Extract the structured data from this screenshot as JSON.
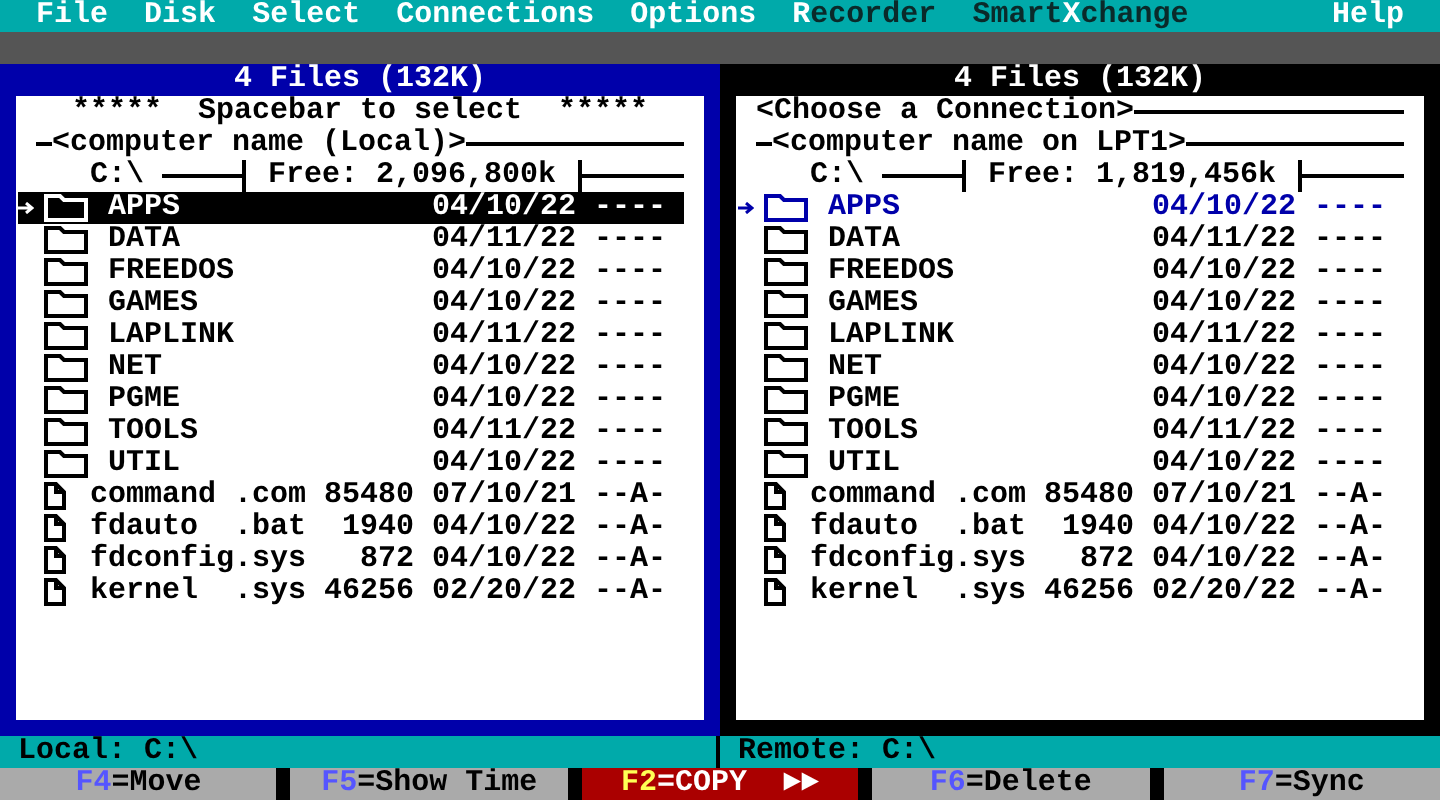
{
  "menu": [
    {
      "hotkey": "F",
      "rest": "ile",
      "bright": true
    },
    {
      "hotkey": "D",
      "rest": "isk",
      "bright": true
    },
    {
      "hotkey": "S",
      "rest": "elect",
      "bright": true
    },
    {
      "hotkey": "C",
      "rest": "onnections",
      "bright": true
    },
    {
      "hotkey": "O",
      "rest": "ptions",
      "bright": true
    },
    {
      "hotkey": "R",
      "rest": "ecorder",
      "bright": false
    },
    {
      "before": "Smart",
      "hotkey": "X",
      "rest": "change",
      "bright": false
    }
  ],
  "help": "Help",
  "panels": [
    {
      "active": true,
      "header": "4 Files (132K)",
      "banner": {
        "kind": "centered",
        "text": "*****  Spacebar to select  *****"
      },
      "computer": "<computer name (Local)>",
      "path": "C:\\",
      "free": "Free: 2,096,800k",
      "status": "Local: C:\\",
      "rows": [
        {
          "kind": "folder",
          "name": "APPS",
          "date": "04/10/22",
          "attr": "----",
          "selected": true
        },
        {
          "kind": "folder",
          "name": "DATA",
          "date": "04/11/22",
          "attr": "----",
          "selected": false
        },
        {
          "kind": "folder",
          "name": "FREEDOS",
          "date": "04/10/22",
          "attr": "----",
          "selected": false
        },
        {
          "kind": "folder",
          "name": "GAMES",
          "date": "04/10/22",
          "attr": "----",
          "selected": false
        },
        {
          "kind": "folder",
          "name": "LAPLINK",
          "date": "04/11/22",
          "attr": "----",
          "selected": false
        },
        {
          "kind": "folder",
          "name": "NET",
          "date": "04/10/22",
          "attr": "----",
          "selected": false
        },
        {
          "kind": "folder",
          "name": "PGME",
          "date": "04/10/22",
          "attr": "----",
          "selected": false
        },
        {
          "kind": "folder",
          "name": "TOOLS",
          "date": "04/11/22",
          "attr": "----",
          "selected": false
        },
        {
          "kind": "folder",
          "name": "UTIL",
          "date": "04/10/22",
          "attr": "----",
          "selected": false
        },
        {
          "kind": "file",
          "name": "command",
          "ext": ".com",
          "size": "85480",
          "date": "07/10/21",
          "attr": "--A-",
          "selected": false
        },
        {
          "kind": "file",
          "name": "fdauto",
          "ext": ".bat",
          "size": "1940",
          "date": "04/10/22",
          "attr": "--A-",
          "selected": false
        },
        {
          "kind": "file",
          "name": "fdconfig",
          "ext": ".sys",
          "size": "872",
          "date": "04/10/22",
          "attr": "--A-",
          "selected": false
        },
        {
          "kind": "file",
          "name": "kernel",
          "ext": ".sys",
          "size": "46256",
          "date": "02/20/22",
          "attr": "--A-",
          "selected": false
        }
      ]
    },
    {
      "active": false,
      "header": "4 Files (132K)",
      "banner": {
        "kind": "ruled",
        "text": "<Choose a Connection>"
      },
      "computer": "<computer name on LPT1>",
      "path": "C:\\",
      "free": "Free: 1,819,456k",
      "status": "Remote: C:\\",
      "rows": [
        {
          "kind": "folder",
          "name": "APPS",
          "date": "04/10/22",
          "attr": "----",
          "selected": true
        },
        {
          "kind": "folder",
          "name": "DATA",
          "date": "04/11/22",
          "attr": "----",
          "selected": false
        },
        {
          "kind": "folder",
          "name": "FREEDOS",
          "date": "04/10/22",
          "attr": "----",
          "selected": false
        },
        {
          "kind": "folder",
          "name": "GAMES",
          "date": "04/10/22",
          "attr": "----",
          "selected": false
        },
        {
          "kind": "folder",
          "name": "LAPLINK",
          "date": "04/11/22",
          "attr": "----",
          "selected": false
        },
        {
          "kind": "folder",
          "name": "NET",
          "date": "04/10/22",
          "attr": "----",
          "selected": false
        },
        {
          "kind": "folder",
          "name": "PGME",
          "date": "04/10/22",
          "attr": "----",
          "selected": false
        },
        {
          "kind": "folder",
          "name": "TOOLS",
          "date": "04/11/22",
          "attr": "----",
          "selected": false
        },
        {
          "kind": "folder",
          "name": "UTIL",
          "date": "04/10/22",
          "attr": "----",
          "selected": false
        },
        {
          "kind": "file",
          "name": "command",
          "ext": ".com",
          "size": "85480",
          "date": "07/10/21",
          "attr": "--A-",
          "selected": false
        },
        {
          "kind": "file",
          "name": "fdauto",
          "ext": ".bat",
          "size": "1940",
          "date": "04/10/22",
          "attr": "--A-",
          "selected": false
        },
        {
          "kind": "file",
          "name": "fdconfig",
          "ext": ".sys",
          "size": "872",
          "date": "04/10/22",
          "attr": "--A-",
          "selected": false
        },
        {
          "kind": "file",
          "name": "kernel",
          "ext": ".sys",
          "size": "46256",
          "date": "02/20/22",
          "attr": "--A-",
          "selected": false
        }
      ]
    }
  ],
  "function_keys": [
    {
      "key": "F4",
      "label": "=Move",
      "primary": false
    },
    {
      "key": "F5",
      "label": "=Show Time",
      "primary": false
    },
    {
      "key": "F2",
      "label": "=COPY",
      "arrows": "►►",
      "primary": true
    },
    {
      "key": "F6",
      "label": "=Delete",
      "primary": false
    },
    {
      "key": "F7",
      "label": "=Sync",
      "primary": false
    }
  ]
}
